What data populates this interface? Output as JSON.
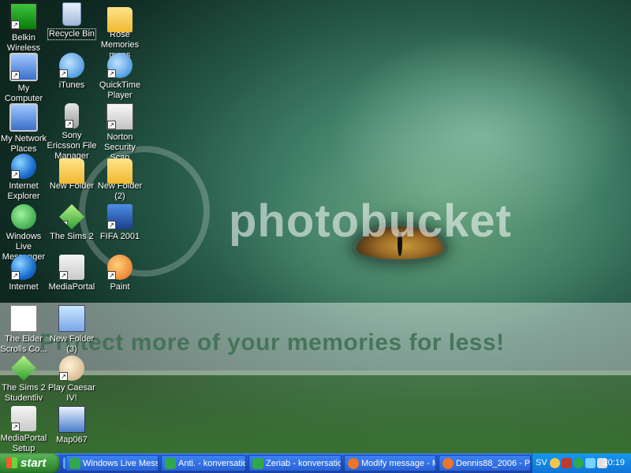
{
  "desktop": {
    "icons": [
      {
        "label": "Belkin Wireless utility",
        "icon": "belkin-icon"
      },
      {
        "label": "Recycle Bin",
        "icon": "recycle-bin-icon"
      },
      {
        "label": "Rose Memories maps",
        "icon": "folder-icon"
      },
      {
        "label": "My Computer",
        "icon": "my-computer-icon"
      },
      {
        "label": "iTunes",
        "icon": "itunes-icon"
      },
      {
        "label": "QuickTime Player",
        "icon": "quicktime-icon"
      },
      {
        "label": "My Network Places",
        "icon": "network-places-icon"
      },
      {
        "label": "Sony Ericsson File Manager",
        "icon": "phone-icon"
      },
      {
        "label": "Norton Security Scan",
        "icon": "norton-icon"
      },
      {
        "label": "Internet Explorer",
        "icon": "internet-explorer-icon"
      },
      {
        "label": "New Folder",
        "icon": "folder-icon"
      },
      {
        "label": "New Folder (2)",
        "icon": "folder-icon"
      },
      {
        "label": "Windows Live Messenger",
        "icon": "messenger-icon"
      },
      {
        "label": "The Sims 2",
        "icon": "sims-icon"
      },
      {
        "label": "FIFA 2001",
        "icon": "fifa-icon"
      },
      {
        "label": "Internet",
        "icon": "internet-icon"
      },
      {
        "label": "MediaPortal",
        "icon": "mediaportal-icon"
      },
      {
        "label": "Paint",
        "icon": "paint-icon"
      },
      {
        "label": "The Elder Scrolls Co...",
        "icon": "document-icon"
      },
      {
        "label": "New Folder (3)",
        "icon": "multi-folder-icon"
      },
      {
        "label": "The Sims 2 Studentliv",
        "icon": "sims-icon"
      },
      {
        "label": "Play Caesar IV!",
        "icon": "caesar-icon"
      },
      {
        "label": "MediaPortal Setup",
        "icon": "setup-icon"
      },
      {
        "label": "Map067",
        "icon": "map-icon"
      }
    ],
    "watermark": "photobucket",
    "banner": "Protect more of your memories for less!"
  },
  "taskbar": {
    "start_label": "start",
    "tasks": [
      {
        "label": "Windows Live Mess...",
        "icon": "messenger-icon"
      },
      {
        "label": "Anti. - konversation",
        "icon": "messenger-icon"
      },
      {
        "label": "Zeriab - konversation",
        "icon": "messenger-icon"
      },
      {
        "label": "Modify message - M...",
        "icon": "firefox-icon"
      },
      {
        "label": "Dennis88_2006 - P...",
        "icon": "firefox-icon"
      }
    ],
    "tray": {
      "language": "SV",
      "clock": "20:19"
    }
  }
}
